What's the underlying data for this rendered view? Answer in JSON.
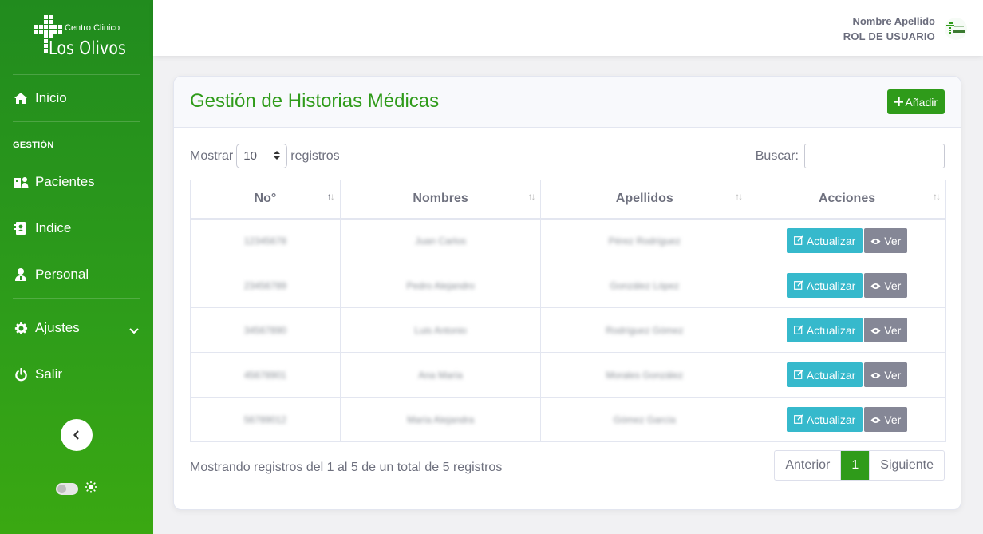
{
  "brand": {
    "top_text": "Centro Clinico",
    "main_text": "Los Olivos"
  },
  "sidebar": {
    "inicio": "Inicio",
    "section_heading": "GESTIÓN",
    "pacientes": "Pacientes",
    "indice": "Indice",
    "personal": "Personal",
    "ajustes": "Ajustes",
    "salir": "Salir"
  },
  "topbar": {
    "user_name": "Nombre Apellido",
    "user_role": "ROL DE USUARIO"
  },
  "page": {
    "title": "Gestión de Historias Médicas",
    "add_label": "Añadir"
  },
  "controls": {
    "show_label": "Mostrar",
    "page_size": "10",
    "records_label": "registros",
    "search_label": "Buscar:",
    "search_value": ""
  },
  "table": {
    "headers": [
      "No°",
      "Nombres",
      "Apellidos",
      "Acciones"
    ],
    "rows": [
      {
        "no": "12345678",
        "nombres": "Juan Carlos",
        "apellidos": "Pérez Rodríguez"
      },
      {
        "no": "23456789",
        "nombres": "Pedro Alejandro",
        "apellidos": "González López"
      },
      {
        "no": "34567890",
        "nombres": "Luis Antonio",
        "apellidos": "Rodríguez Gómez"
      },
      {
        "no": "45678901",
        "nombres": "Ana María",
        "apellidos": "Morales González"
      },
      {
        "no": "56789012",
        "nombres": "María Alejandra",
        "apellidos": "Gómez García"
      }
    ],
    "update_label": "Actualizar",
    "view_label": "Ver"
  },
  "footer": {
    "info": "Mostrando registros del 1 al 5 de un total de 5 registros",
    "prev": "Anterior",
    "current_page": "1",
    "next": "Siguiente"
  },
  "colors": {
    "brand_green": "#2f9b1a",
    "info_teal": "#36b9cc",
    "secondary_gray": "#858796"
  }
}
